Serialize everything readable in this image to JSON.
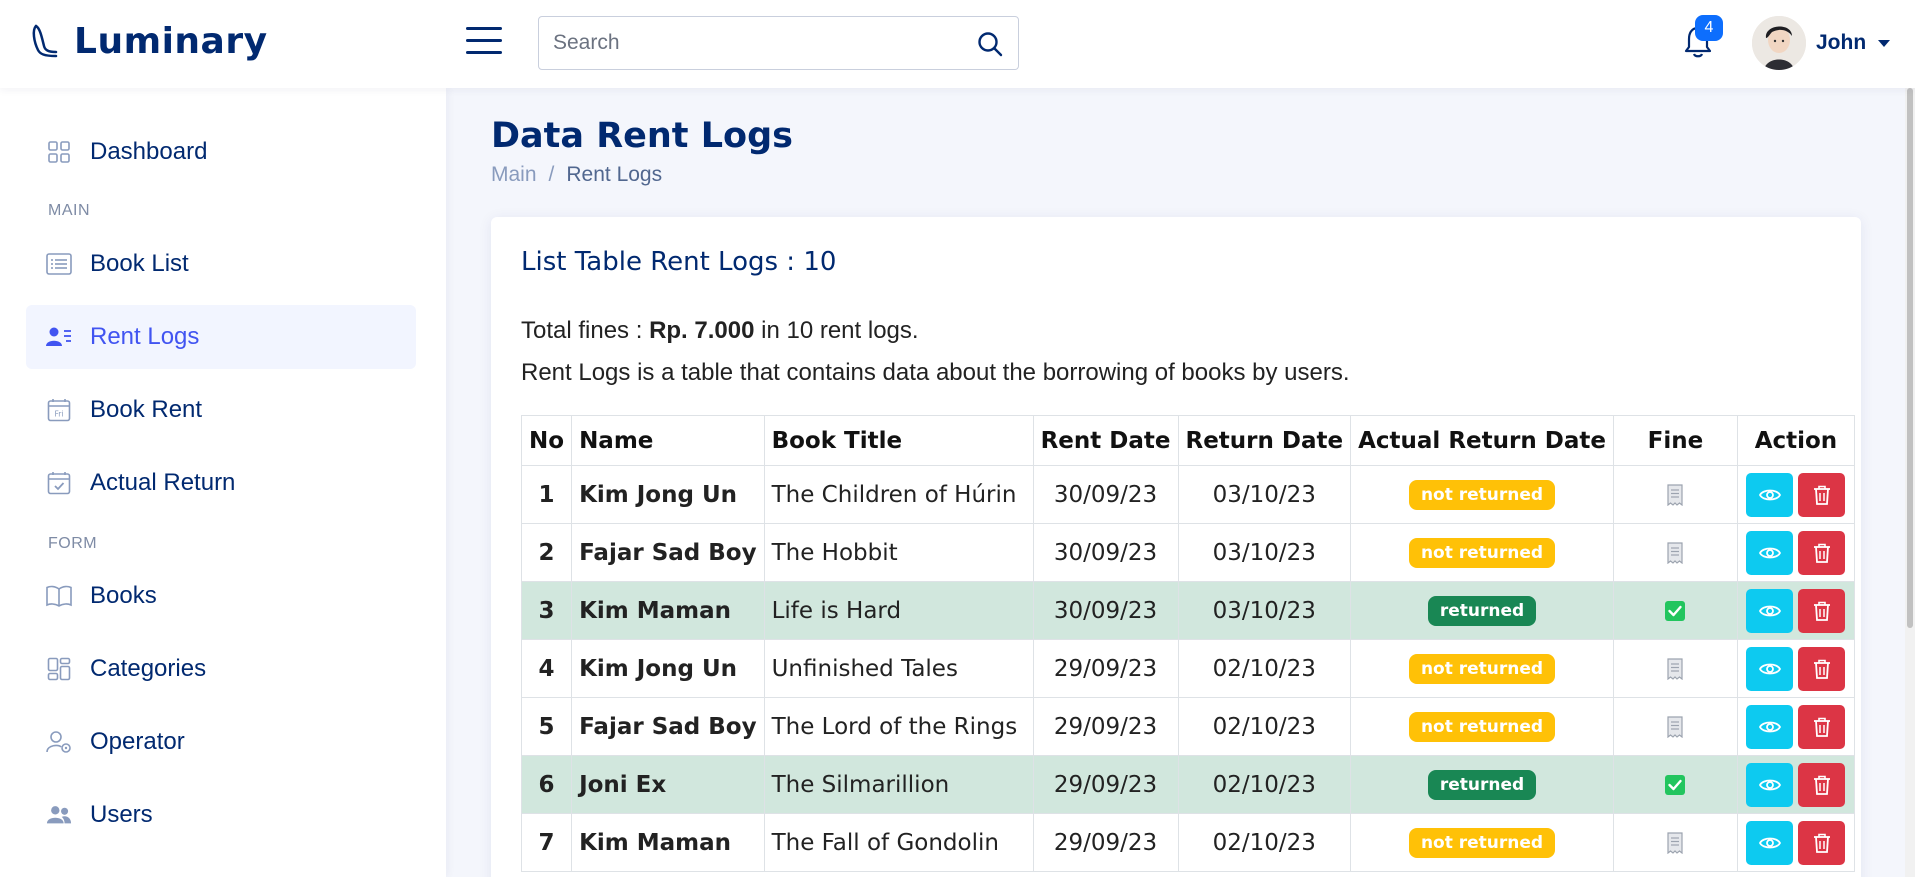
{
  "app": {
    "name": "Luminary"
  },
  "header": {
    "search_placeholder": "Search",
    "notifications_count": "4",
    "user_name": "John"
  },
  "sidebar": {
    "dashboard": "Dashboard",
    "heading_main": "MAIN",
    "book_list": "Book List",
    "rent_logs": "Rent Logs",
    "book_rent": "Book Rent",
    "actual_return": "Actual Return",
    "heading_form": "FORM",
    "books": "Books",
    "categories": "Categories",
    "operator": "Operator",
    "users": "Users"
  },
  "page": {
    "title": "Data Rent Logs",
    "breadcrumb": [
      "Main",
      "/",
      "Rent Logs"
    ]
  },
  "card": {
    "title": "List Table Rent Logs : 10",
    "total_prefix": "Total fines : ",
    "total_amount": "Rp. 7.000",
    "total_suffix": " in 10 rent logs.",
    "description": "Rent Logs is a table that contains data about the borrowing of books by users."
  },
  "table": {
    "headers": [
      "No",
      "Name",
      "Book Title",
      "Rent Date",
      "Return Date",
      "Actual Return Date",
      "Fine",
      "Action"
    ],
    "rows": [
      {
        "no": "1",
        "name": "Kim Jong Un",
        "book": "The Children of Húrin",
        "rent": "30/09/23",
        "ret": "03/10/23",
        "status": "not returned",
        "returned": false
      },
      {
        "no": "2",
        "name": "Fajar Sad Boy",
        "book": "The Hobbit",
        "rent": "30/09/23",
        "ret": "03/10/23",
        "status": "not returned",
        "returned": false
      },
      {
        "no": "3",
        "name": "Kim Maman",
        "book": "Life is Hard",
        "rent": "30/09/23",
        "ret": "03/10/23",
        "status": "returned",
        "returned": true
      },
      {
        "no": "4",
        "name": "Kim Jong Un",
        "book": "Unfinished Tales",
        "rent": "29/09/23",
        "ret": "02/10/23",
        "status": "not returned",
        "returned": false
      },
      {
        "no": "5",
        "name": "Fajar Sad Boy",
        "book": "The Lord of the Rings",
        "rent": "29/09/23",
        "ret": "02/10/23",
        "status": "not returned",
        "returned": false
      },
      {
        "no": "6",
        "name": "Joni Ex",
        "book": "The Silmarillion",
        "rent": "29/09/23",
        "ret": "02/10/23",
        "status": "returned",
        "returned": true
      },
      {
        "no": "7",
        "name": "Kim Maman",
        "book": "The Fall of Gondolin",
        "rent": "29/09/23",
        "ret": "02/10/23",
        "status": "not returned",
        "returned": false
      }
    ]
  },
  "icons": {
    "fine_pending": "receipt-icon",
    "fine_paid": "check-square-icon",
    "view": "eye-icon",
    "delete": "trash-icon"
  },
  "colors": {
    "brand": "#012970",
    "active": "#4154f1",
    "warning": "#ffc107",
    "success": "#198754",
    "info": "#0dcaf0",
    "danger": "#dc3545",
    "row_success": "#d1e7dd"
  }
}
